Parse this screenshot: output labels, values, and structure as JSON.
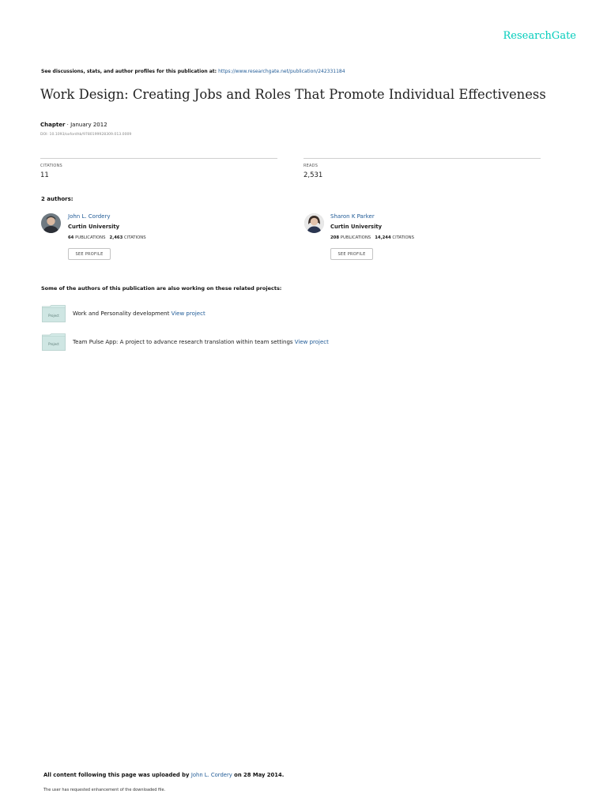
{
  "brand": {
    "logo_text": "ResearchGate",
    "accent_color": "#00ccbb",
    "link_color": "#1f5a96"
  },
  "header": {
    "discuss_text": "See discussions, stats, and author profiles for this publication at: ",
    "discuss_url": "https://www.researchgate.net/publication/242331184"
  },
  "publication": {
    "title": "Work Design: Creating Jobs and Roles That Promote Individual Effectiveness",
    "type": "Chapter",
    "separator": " · ",
    "date": "January 2012",
    "doi": "DOI: 10.1093/oxfordhb/9780199928309.013.0009"
  },
  "stats": {
    "citations_label": "CITATIONS",
    "citations_value": "11",
    "reads_label": "READS",
    "reads_value": "2,531"
  },
  "authors_heading": "2 authors:",
  "authors": [
    {
      "name": "John L. Cordery",
      "affiliation": "Curtin University",
      "publications_count": "64",
      "publications_label": "PUBLICATIONS",
      "citations_count": "2,463",
      "citations_label": "CITATIONS",
      "profile_button": "SEE PROFILE"
    },
    {
      "name": "Sharon K Parker",
      "affiliation": "Curtin University",
      "publications_count": "208",
      "publications_label": "PUBLICATIONS",
      "citations_count": "14,244",
      "citations_label": "CITATIONS",
      "profile_button": "SEE PROFILE"
    }
  ],
  "related": {
    "heading": "Some of the authors of this publication are also working on these related projects:",
    "project_icon_label": "Project",
    "projects": [
      {
        "title": "Work and Personality development ",
        "link": "View project"
      },
      {
        "title": "Team Pulse App: A project to advance research translation within team settings ",
        "link": "View project"
      }
    ]
  },
  "footer": {
    "upload_prefix": "All content following this page was uploaded by ",
    "uploader": "John L. Cordery",
    "upload_suffix": " on 28 May 2014.",
    "enhancement_note": "The user has requested enhancement of the downloaded file."
  }
}
